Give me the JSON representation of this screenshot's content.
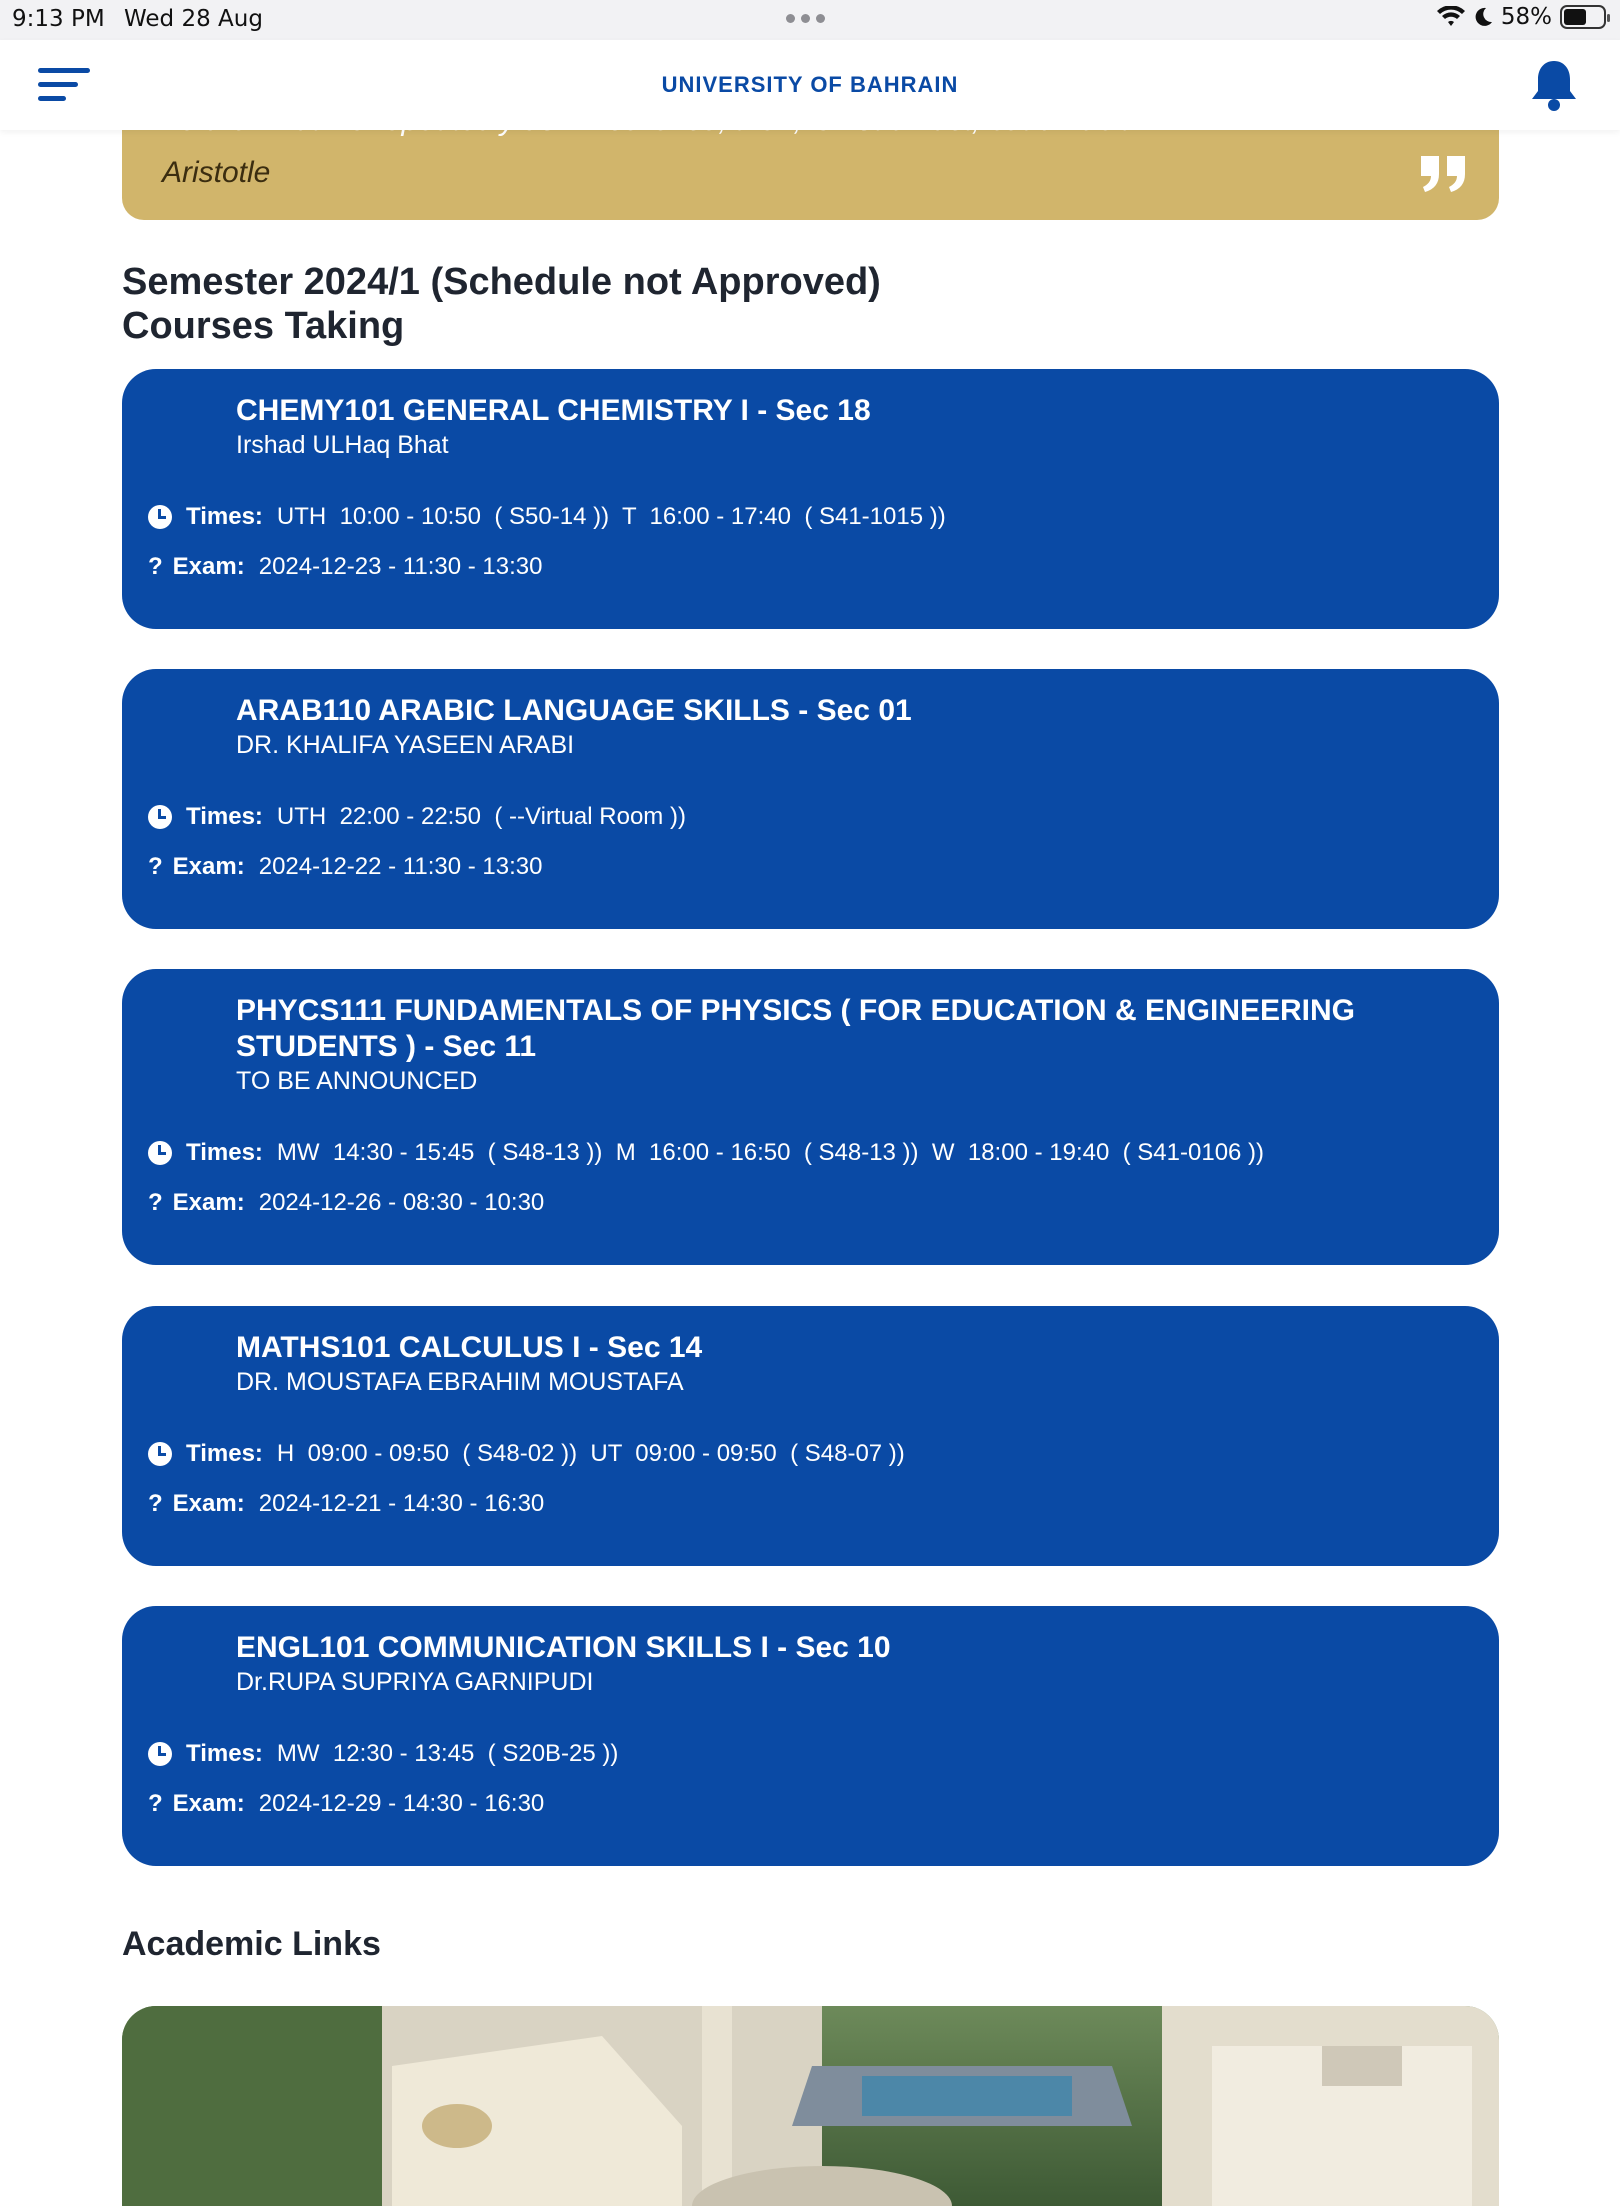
{
  "status_bar": {
    "time": "9:13 PM",
    "date": "Wed 28 Aug",
    "battery": "58%"
  },
  "header": {
    "title": "UNIVERSITY OF BAHRAIN"
  },
  "quote": {
    "text": "We are what we repeatedly do. Excellence, then, is not an act, but a habit.",
    "author": "Aristotle"
  },
  "semester": {
    "title": "Semester 2024/1 (Schedule not Approved)",
    "subtitle": "Courses Taking"
  },
  "labels": {
    "times": "Times:",
    "exam": "Exam:"
  },
  "courses": [
    {
      "title": "CHEMY101 GENERAL CHEMISTRY I - Sec 18",
      "instructor": "Irshad ULHaq Bhat",
      "times": "UTH  10:00 - 10:50  ( S50-14 ))  T  16:00 - 17:40  ( S41-1015 ))",
      "exam": "2024-12-23 - 11:30 - 13:30"
    },
    {
      "title": "ARAB110 ARABIC LANGUAGE SKILLS - Sec 01",
      "instructor": "DR. KHALIFA YASEEN ARABI",
      "times": "UTH  22:00 - 22:50  ( --Virtual Room ))",
      "exam": "2024-12-22 - 11:30 - 13:30"
    },
    {
      "title": "PHYCS111 FUNDAMENTALS OF PHYSICS ( FOR EDUCATION & ENGINEERING STUDENTS ) - Sec 11",
      "instructor": "TO BE ANNOUNCED",
      "times": "MW  14:30 - 15:45  ( S48-13 ))  M  16:00 - 16:50  ( S48-13 ))  W  18:00 - 19:40  ( S41-0106 ))",
      "exam": "2024-12-26 - 08:30 - 10:30"
    },
    {
      "title": "MATHS101 CALCULUS I - Sec 14",
      "instructor": "DR. MOUSTAFA EBRAHIM MOUSTAFA",
      "times": "H  09:00 - 09:50  ( S48-02 ))  UT  09:00 - 09:50  ( S48-07 ))",
      "exam": "2024-12-21 - 14:30 - 16:30"
    },
    {
      "title": "ENGL101 COMMUNICATION SKILLS I - Sec 10",
      "instructor": "Dr.RUPA SUPRIYA GARNIPUDI",
      "times": "MW  12:30 - 13:45  ( S20B-25 ))",
      "exam": "2024-12-29 - 14:30 - 16:30"
    }
  ],
  "academic_links": {
    "title": "Academic Links"
  },
  "colors": {
    "primary": "#0a4aa5",
    "quote_bg": "#d1b56b"
  }
}
